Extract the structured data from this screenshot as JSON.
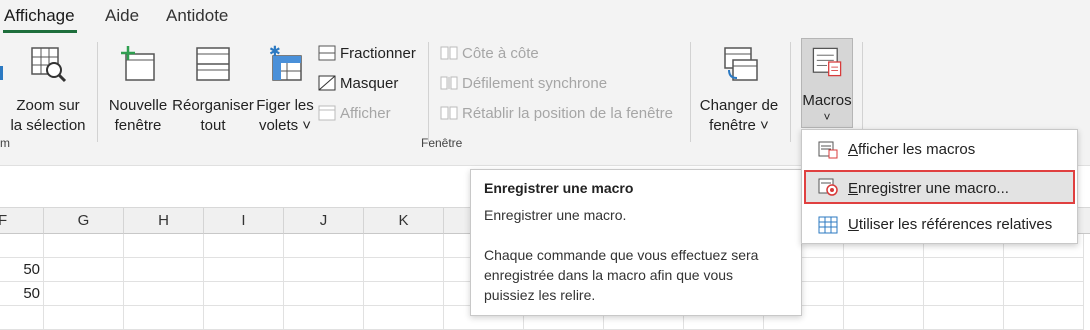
{
  "tabs": [
    {
      "label": "Affichage",
      "active": true
    },
    {
      "label": "Aide",
      "active": false
    },
    {
      "label": "Antidote",
      "active": false
    }
  ],
  "ribbon": {
    "zoom_sel": {
      "line1": "Zoom sur",
      "line2": "la sélection"
    },
    "partial_group_label": "m",
    "new_window": {
      "line1": "Nouvelle",
      "line2": "fenêtre"
    },
    "arrange_all": {
      "line1": "Réorganiser",
      "line2": "tout"
    },
    "freeze": {
      "line1": "Figer les",
      "line2": "volets ˅"
    },
    "split": "Fractionner",
    "hide": "Masquer",
    "unhide": "Afficher",
    "side_by_side": "Côte à côte",
    "sync_scroll": "Défilement synchrone",
    "reset_pos": "Rétablir la position de la fenêtre",
    "switch_windows": {
      "line1": "Changer de",
      "line2": "fenêtre ˅"
    },
    "macros": {
      "label": "Macros",
      "chevron": "˅"
    },
    "group_fenetre": "Fenêtre"
  },
  "grid": {
    "columns": [
      "F",
      "G",
      "H",
      "I",
      "J",
      "K"
    ],
    "values": [
      "50",
      "50"
    ]
  },
  "tooltip": {
    "title": "Enregistrer une macro",
    "line1": "Enregistrer une macro.",
    "line2": "Chaque commande que vous effectuez sera",
    "line3": "enregistrée dans la macro afin que vous",
    "line4": "puissiez les relire."
  },
  "menu": {
    "items": [
      {
        "label": "Afficher les macros",
        "highlighted": false
      },
      {
        "label": "Enregistrer une macro...",
        "highlighted": true
      },
      {
        "label": "Utiliser les références relatives",
        "highlighted": false
      }
    ]
  },
  "colors": {
    "accent": "#1e6e3c",
    "highlight_border": "#e04040"
  },
  "icons": [
    "zoom-selection-icon",
    "new-window-icon",
    "arrange-all-icon",
    "freeze-panes-icon",
    "split-icon",
    "hide-icon",
    "unhide-icon",
    "side-by-side-icon",
    "sync-scroll-icon",
    "reset-position-icon",
    "switch-windows-icon",
    "macros-icon",
    "view-macros-icon",
    "record-macro-icon",
    "relative-refs-icon"
  ]
}
